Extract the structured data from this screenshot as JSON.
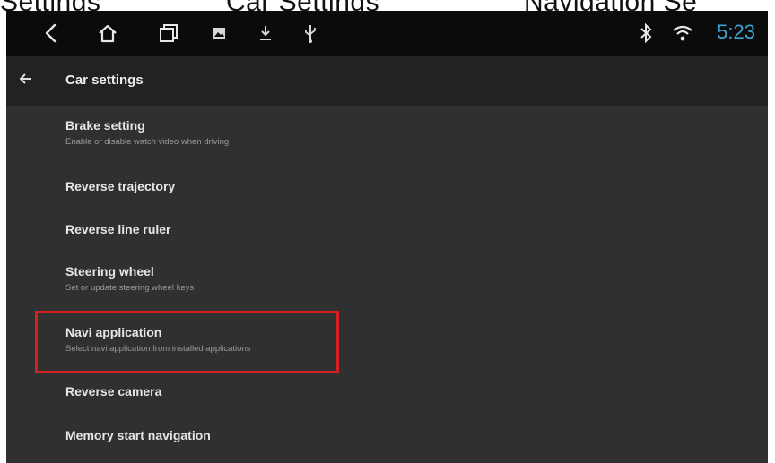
{
  "caption": {
    "part1": "Settings",
    "part2": "Car Settings",
    "part3": "Navigation Se"
  },
  "status_bar": {
    "time": "5:23",
    "icons": [
      "back-icon",
      "home-icon",
      "recents-icon",
      "gallery-icon",
      "download-icon",
      "usb-icon",
      "bluetooth-icon",
      "wifi-icon"
    ]
  },
  "app_bar": {
    "title": "Car settings"
  },
  "items": [
    {
      "title": "Brake setting",
      "subtitle": "Enable or disable watch video when driving"
    },
    {
      "title": "Reverse trajectory",
      "subtitle": ""
    },
    {
      "title": "Reverse line ruler",
      "subtitle": ""
    },
    {
      "title": "Steering wheel",
      "subtitle": "Set or update steering wheel keys"
    },
    {
      "title": "Navi application",
      "subtitle": "Select navi application from installed applications"
    },
    {
      "title": "Reverse camera",
      "subtitle": ""
    },
    {
      "title": "Memory start navigation",
      "subtitle": ""
    }
  ],
  "colors": {
    "accent_clock": "#3fa3d6",
    "highlight_border": "#d42020",
    "background": "#303030",
    "status_bar": "#0b0b0b",
    "app_bar": "#222222"
  }
}
